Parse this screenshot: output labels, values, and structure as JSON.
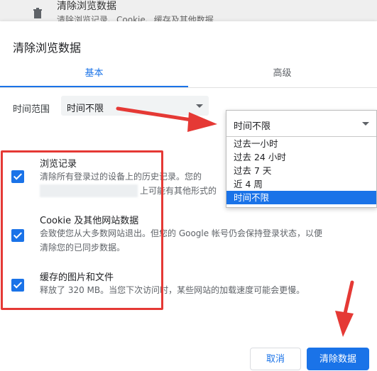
{
  "background": {
    "title": "清除浏览数据",
    "subtitle": "清除浏览记录、Cookie、缓存及其他数据"
  },
  "dialog": {
    "title": "清除浏览数据",
    "tabs": [
      {
        "label": "基本",
        "active": true
      },
      {
        "label": "高级",
        "active": false
      }
    ],
    "time_range": {
      "label": "时间范围",
      "value": "时间不限"
    },
    "dropdown": {
      "value": "时间不限",
      "options": [
        {
          "label": "过去一小时",
          "selected": false
        },
        {
          "label": "过去 24 小时",
          "selected": false
        },
        {
          "label": "过去 7 天",
          "selected": false
        },
        {
          "label": "近 4 周",
          "selected": false
        },
        {
          "label": "时间不限",
          "selected": true
        }
      ]
    },
    "items": [
      {
        "title": "浏览记录",
        "desc": "清除所有登录过的设备上的历史记录。您的",
        "desc2": "上可能有其他形式的",
        "checked": true
      },
      {
        "title": "Cookie 及其他网站数据",
        "desc": "会致使您从大多数网站退出。但您的 Google 帐号仍会保持登录状态，以便",
        "desc2": "清除您的已同步数据。",
        "checked": true
      },
      {
        "title": "缓存的图片和文件",
        "desc": "释放了 320 MB。当您下次访问时，某些网站的加载速度可能会更慢。",
        "checked": true
      }
    ],
    "buttons": {
      "cancel": "取消",
      "clear": "清除数据"
    }
  },
  "colors": {
    "accent": "#1a73e8",
    "annotation": "#e53935"
  }
}
